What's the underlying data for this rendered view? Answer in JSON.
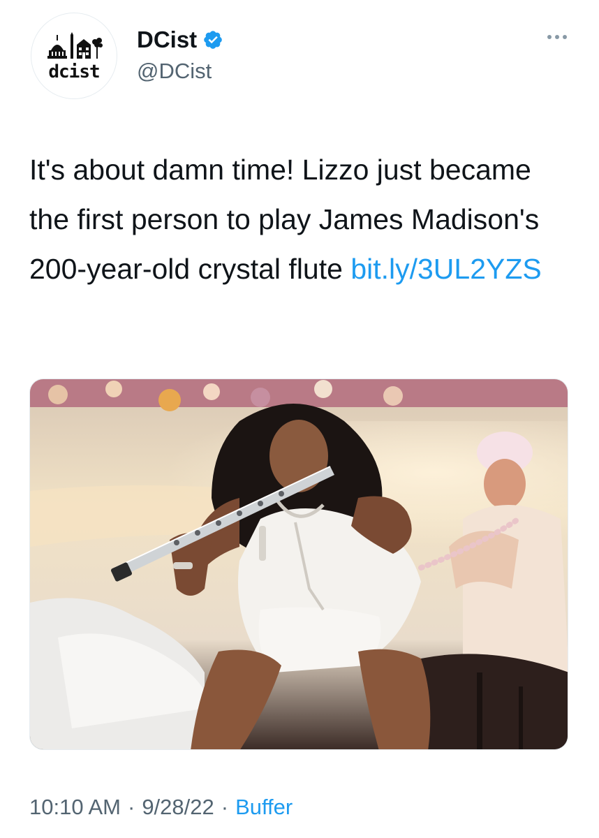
{
  "account": {
    "display_name": "DCist",
    "handle": "@DCist",
    "avatar_wordmark": "dcist",
    "verified_icon": "verified-badge-icon"
  },
  "tweet": {
    "text": "It's about damn time! Lizzo just became the first person to play James Madison's 200-year-old crystal flute ",
    "link": "bit.ly/3UL2YZS"
  },
  "media": {
    "icon": "photo"
  },
  "meta": {
    "time": "10:10 AM",
    "separator": "·",
    "date": "9/28/22",
    "source": "Buffer"
  },
  "colors": {
    "link": "#1d9bf0",
    "secondary": "#536471",
    "verified": "#1d9bf0"
  }
}
